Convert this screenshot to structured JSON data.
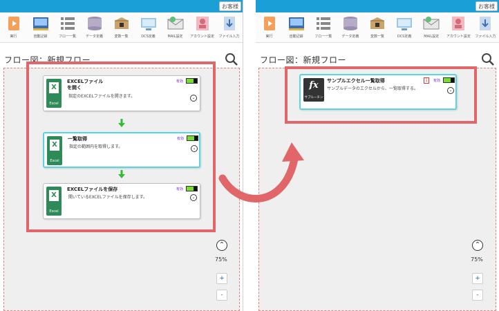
{
  "topbar": {
    "guest_label": "お客様"
  },
  "toolbar": {
    "tools": [
      {
        "label": "実行",
        "icon": "play-icon"
      },
      {
        "label": "自動記録",
        "icon": "record-icon"
      },
      {
        "label": "フロー一覧",
        "icon": "flow-list-icon"
      },
      {
        "label": "データ定義",
        "icon": "database-icon"
      },
      {
        "label": "変数一覧",
        "icon": "box-icon"
      },
      {
        "label": "DCS定義",
        "icon": "monitor-icon"
      },
      {
        "label": "MAIL設定",
        "icon": "mail-icon"
      },
      {
        "label": "アカウント設定",
        "icon": "account-icon"
      },
      {
        "label": "ファイル入力",
        "icon": "file-input-icon"
      }
    ],
    "right_tools": [
      {
        "label": "実行",
        "icon": "play-icon"
      },
      {
        "label": "自動記録",
        "icon": "record-icon"
      },
      {
        "label": "フロー一覧",
        "icon": "flow-list-icon"
      },
      {
        "label": "データ定義",
        "icon": "database-icon"
      },
      {
        "label": "変数一覧",
        "icon": "box-icon"
      },
      {
        "label": "DCS定義",
        "icon": "monitor-icon"
      },
      {
        "label": "MAIL設定",
        "icon": "mail-icon"
      },
      {
        "label": "アカウント設定",
        "icon": "account-icon"
      },
      {
        "label": "ファイル入力",
        "icon": "file-input-icon"
      }
    ]
  },
  "left": {
    "flow_title": "フロー図：新規フロー",
    "nodes": [
      {
        "title": "EXCELファイル\nを開く",
        "desc": "指定のEXCELファイルを開きます。",
        "status": "有効",
        "icon_caption": "Excel"
      },
      {
        "title": "一覧取得",
        "desc": "指定の範囲内を取得します。",
        "status": "有効",
        "icon_caption": "Excel"
      },
      {
        "title": "EXCELファイルを保存",
        "desc": "開いているEXCELファイルを保存します。",
        "status": "有効",
        "icon_caption": "Excel"
      }
    ],
    "zoom": "75%"
  },
  "right": {
    "flow_title": "フロー図：新規フロー",
    "node": {
      "title": "サンプルエクセル一覧取得",
      "desc": "サンプルデータのエクセルから、一覧取得する。",
      "status": "有効",
      "badge": "1",
      "icon_caption": "サブルーチン",
      "icon_glyph": "fx"
    },
    "zoom": "75%"
  },
  "controls": {
    "up": "⌃",
    "plus": "+",
    "minus": "-",
    "chevron": "⌄"
  },
  "colors": {
    "topbar": "#1a9fd6",
    "highlight": "#e0666a",
    "selected": "#55d6e3",
    "excel": "#2e8b57",
    "battery": "#77dd33",
    "arrow": "#33bb33"
  }
}
